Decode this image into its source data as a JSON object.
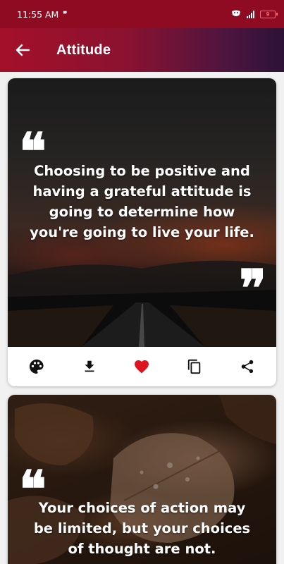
{
  "status_bar": {
    "time": "11:55 AM",
    "notification_glyph": "❞",
    "battery_level": "9",
    "icons": [
      "mask-icon",
      "signal-icon",
      "battery-icon"
    ]
  },
  "app_bar": {
    "title": "Attitude",
    "back_icon": "arrow-back-icon"
  },
  "colors": {
    "status_bar": "#8e0b22",
    "app_bar_start": "#a4102a",
    "app_bar_end": "#2d1236",
    "favorite": "#e0141e"
  },
  "quotes": [
    {
      "text": "Choosing to be positive and having a grateful attitude is going to determine how you're going to live your life.",
      "open_mark": "❝",
      "close_mark": "❞",
      "background": "dark road under sunset clouds",
      "actions": [
        {
          "name": "palette-icon"
        },
        {
          "name": "download-icon"
        },
        {
          "name": "favorite-icon",
          "active": true
        },
        {
          "name": "copy-icon"
        },
        {
          "name": "share-icon"
        }
      ]
    },
    {
      "text": "Your choices of action may be limited, but your choices of thought are not.",
      "open_mark": "❝",
      "background": "autumn leaves with water drops"
    }
  ]
}
